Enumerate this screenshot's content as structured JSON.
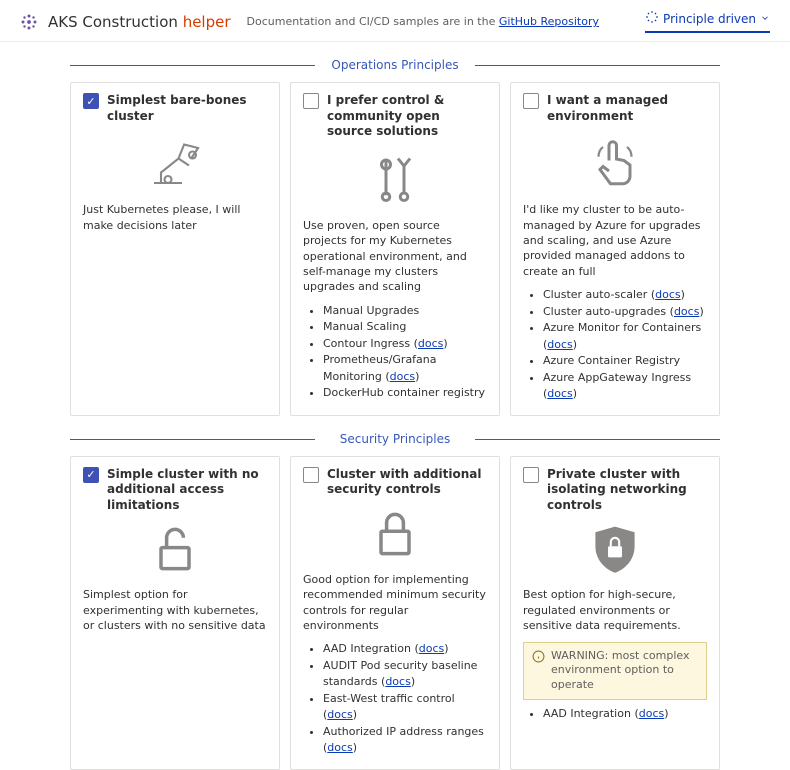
{
  "header": {
    "title_a": "AKS Construction",
    "title_b": "helper",
    "subtitle_prefix": "Documentation and CI/CD samples are in the ",
    "repo_link": "GitHub Repository",
    "pivot_label": "Principle driven"
  },
  "sections": {
    "ops_title": "Operations Principles",
    "sec_title": "Security Principles"
  },
  "ops": [
    {
      "label": "Simplest bare-bones cluster",
      "checked": true,
      "desc": "Just Kubernetes please, I will make decisions later"
    },
    {
      "label": "I prefer control & community open source solutions",
      "checked": false,
      "desc": "Use proven, open source projects for my Kubernetes operational environment, and self-manage my clusters upgrades and scaling",
      "bullets": [
        "Manual Upgrades",
        "Manual Scaling",
        "Contour Ingress",
        "Prometheus/Grafana Monitoring",
        "DockerHub container registry"
      ],
      "docs_at": [
        2,
        3
      ]
    },
    {
      "label": "I want a managed environment",
      "checked": false,
      "desc": "I'd like my cluster to be auto-managed by Azure for upgrades and scaling, and use Azure provided managed addons to create an full",
      "bullets": [
        "Cluster auto-scaler",
        "Cluster auto-upgrades",
        "Azure Monitor for Containers",
        "Azure Container Registry",
        "Azure AppGateway Ingress"
      ],
      "docs_at": [
        0,
        1,
        2,
        4
      ]
    }
  ],
  "sec": [
    {
      "label": "Simple cluster with no additional access limitations",
      "checked": true,
      "desc": "Simplest option for experimenting with kubernetes, or clusters with no sensitive data"
    },
    {
      "label": "Cluster with additional security controls",
      "checked": false,
      "desc": "Good option for implementing recommended minimum security controls for regular environments",
      "bullets": [
        "AAD Integration",
        "AUDIT Pod security baseline standards",
        "East-West traffic control",
        "Authorized IP address ranges"
      ],
      "docs_at": [
        0,
        1,
        2,
        3
      ]
    },
    {
      "label": "Private cluster with isolating networking controls",
      "checked": false,
      "desc": "Best option for high-secure, regulated environments or sensitive data requirements.",
      "warning": "WARNING: most complex environment option to operate",
      "bullets": [
        "AAD Integration"
      ],
      "docs_at": [
        0
      ]
    }
  ],
  "docs_label": "docs"
}
